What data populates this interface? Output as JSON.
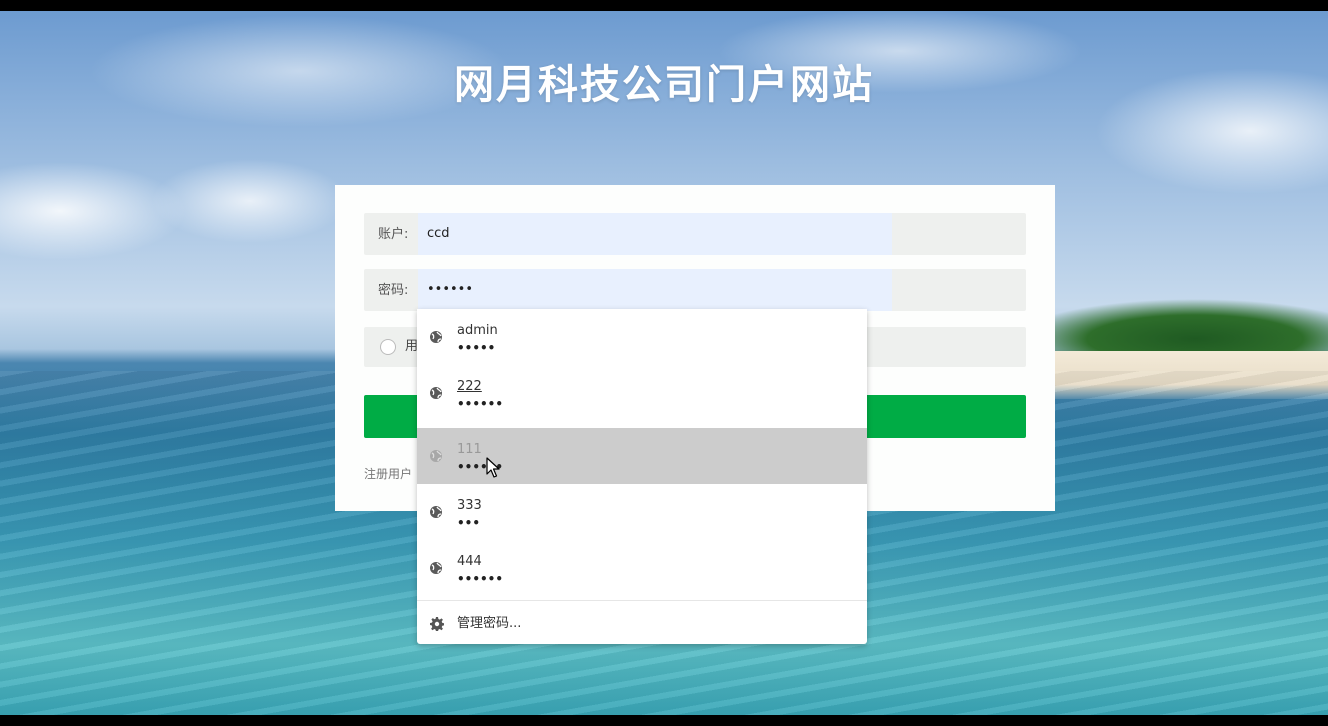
{
  "site": {
    "title": "网月科技公司门户网站"
  },
  "login_form": {
    "account_label": "账户:",
    "account_value": "ccd",
    "password_label": "密码:",
    "password_value": "••••••",
    "role_label": "用",
    "register_link": "注册用户"
  },
  "autofill_dropdown": {
    "items": [
      {
        "username": "admin",
        "password_mask": "•••••"
      },
      {
        "username": "222",
        "password_mask": "••••••"
      },
      {
        "username": "111",
        "password_mask": "••••••"
      },
      {
        "username": "333",
        "password_mask": "•••"
      },
      {
        "username": "444",
        "password_mask": "••••••"
      }
    ],
    "hovered_index": 2,
    "manage_label": "管理密码..."
  },
  "colors": {
    "login_button": "#00ac45",
    "autofill_bg": "#e8f0fe",
    "hover_bg": "#cccccc"
  }
}
